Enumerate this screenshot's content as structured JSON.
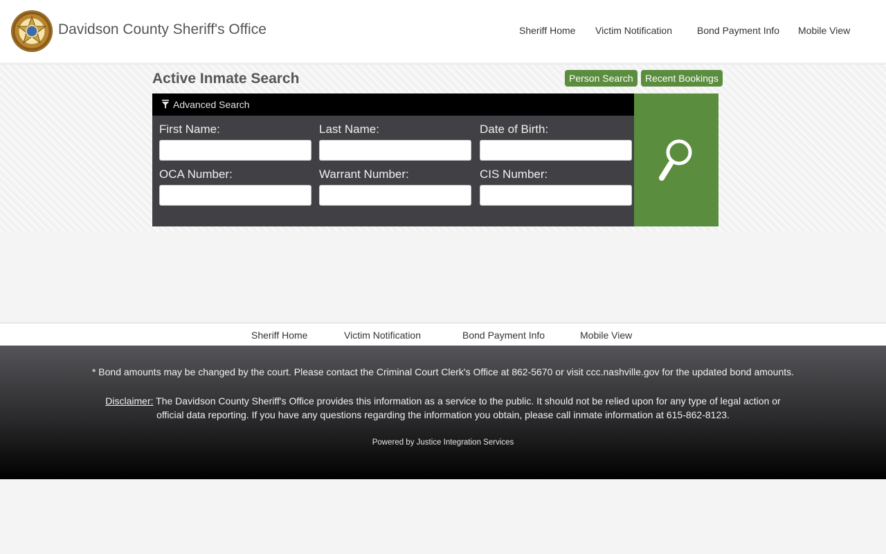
{
  "header": {
    "site_title": "Davidson County Sheriff's Office",
    "nav": [
      "Sheriff Home",
      "Victim Notification",
      "Bond Payment Info",
      "Mobile View"
    ]
  },
  "search": {
    "page_title": "Active Inmate Search",
    "person_search_label": "Person Search",
    "recent_bookings_label": "Recent Bookings",
    "advanced_search_label": "Advanced Search",
    "fields": [
      {
        "label": "First Name:",
        "value": ""
      },
      {
        "label": "Last Name:",
        "value": ""
      },
      {
        "label": "Date of Birth:",
        "value": ""
      },
      {
        "label": "OCA Number:",
        "value": ""
      },
      {
        "label": "Warrant Number:",
        "value": ""
      },
      {
        "label": "CIS Number:",
        "value": ""
      }
    ],
    "search_icon": "search-icon",
    "accent_color": "#5b8d3e"
  },
  "footer": {
    "nav": [
      "Sheriff Home",
      "Victim Notification",
      "Bond Payment Info",
      "Mobile View"
    ],
    "bond_note": "* Bond amounts may be changed by the court. Please contact the Criminal Court Clerk's Office at 862-5670 or visit ccc.nashville.gov for the updated bond amounts.",
    "disclaimer_label": "Disclaimer:",
    "disclaimer_text": " The Davidson County Sheriff's Office provides this information as a service to the public. It should not be relied upon for any type of legal action or official data reporting. If you have any questions regarding the information you obtain, please call inmate information at 615-862-8123.",
    "powered_by": "Powered by Justice Integration Services"
  }
}
